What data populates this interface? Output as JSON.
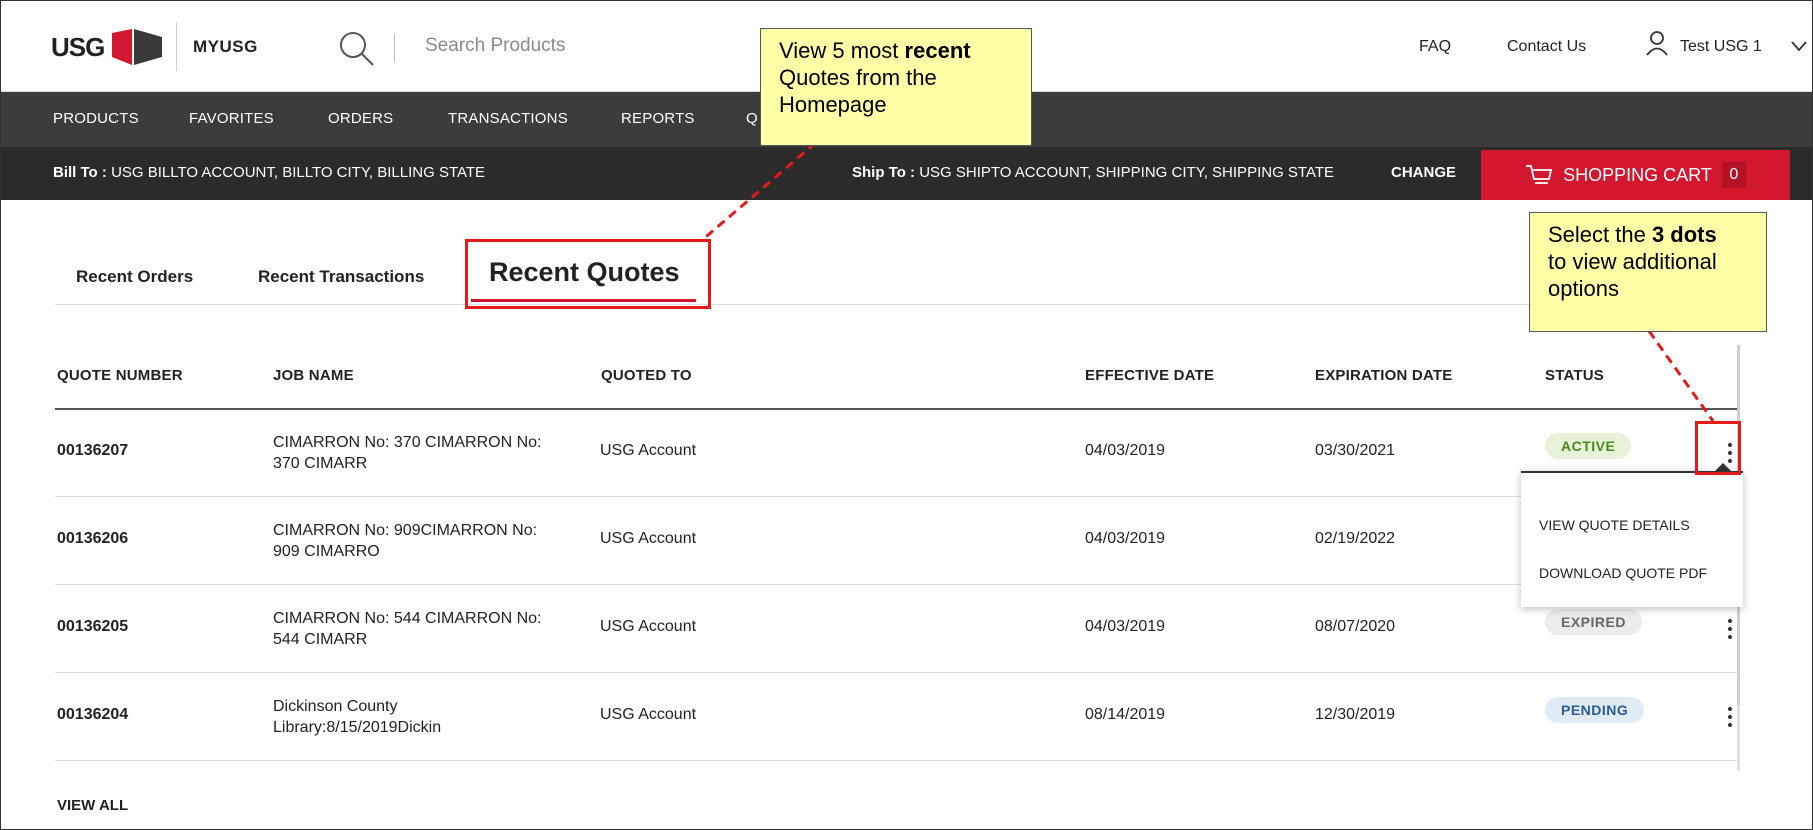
{
  "header": {
    "logo_text": "USG",
    "app_name": "MYUSG",
    "search_placeholder": "Search Products",
    "faq": "FAQ",
    "contact": "Contact Us",
    "user": "Test USG 1"
  },
  "nav": {
    "items": [
      "PRODUCTS",
      "FAVORITES",
      "ORDERS",
      "TRANSACTIONS",
      "REPORTS",
      "Q"
    ]
  },
  "billing": {
    "bill_label": "Bill To :",
    "bill_value": "USG BILLTO ACCOUNT, BILLTO CITY, BILLING STATE",
    "ship_label": "Ship To :",
    "ship_value": "USG SHIPTO ACCOUNT, SHIPPING CITY, SHIPPING STATE",
    "change": "CHANGE",
    "cart_label": "SHOPPING CART",
    "cart_count": "0"
  },
  "tabs": {
    "orders": "Recent Orders",
    "transactions": "Recent Transactions",
    "quotes": "Recent Quotes"
  },
  "table": {
    "headers": {
      "quote_number": "QUOTE NUMBER",
      "job_name": "JOB NAME",
      "quoted_to": "QUOTED TO",
      "effective": "EFFECTIVE DATE",
      "expiration": "EXPIRATION DATE",
      "status": "STATUS"
    },
    "rows": [
      {
        "quote_number": "00136207",
        "job1": "CIMARRON No: 370 CIMARRON No:",
        "job2": "370 CIMARR",
        "quoted_to": "USG Account",
        "effective": "04/03/2019",
        "expiration": "03/30/2021",
        "status": "ACTIVE"
      },
      {
        "quote_number": "00136206",
        "job1": "CIMARRON No: 909CIMARRON No:",
        "job2": "909 CIMARRO",
        "quoted_to": "USG Account",
        "effective": "04/03/2019",
        "expiration": "02/19/2022",
        "status": ""
      },
      {
        "quote_number": "00136205",
        "job1": "CIMARRON No: 544 CIMARRON No:",
        "job2": "544 CIMARR",
        "quoted_to": "USG Account",
        "effective": "04/03/2019",
        "expiration": "08/07/2020",
        "status": "EXPIRED"
      },
      {
        "quote_number": "00136204",
        "job1": "Dickinson County",
        "job2": "Library:8/15/2019Dickin",
        "quoted_to": "USG Account",
        "effective": "08/14/2019",
        "expiration": "12/30/2019",
        "status": "PENDING"
      }
    ],
    "view_all": "VIEW ALL"
  },
  "dropdown": {
    "view_details": "VIEW QUOTE DETAILS",
    "download_pdf": "DOWNLOAD QUOTE PDF"
  },
  "annotations": {
    "callout1_a": "View 5 most ",
    "callout1_b": "recent",
    "callout1_c": "Quotes from the",
    "callout1_d": "Homepage",
    "callout2_a": "Select the ",
    "callout2_b": "3 dots",
    "callout2_c": "to view additional",
    "callout2_d": "options"
  },
  "colors": {
    "brand_red": "#d2172f",
    "nav_bg": "#3c3c3c",
    "bill_bg": "#2b2b2b",
    "callout_bg": "#ffffa8",
    "active_badge_bg": "#e6f2d9",
    "active_badge_fg": "#4c8a1e",
    "pending_badge_bg": "#e1ebf5",
    "pending_badge_fg": "#2a5d8f",
    "expired_badge_bg": "#ececec",
    "expired_badge_fg": "#666666"
  }
}
